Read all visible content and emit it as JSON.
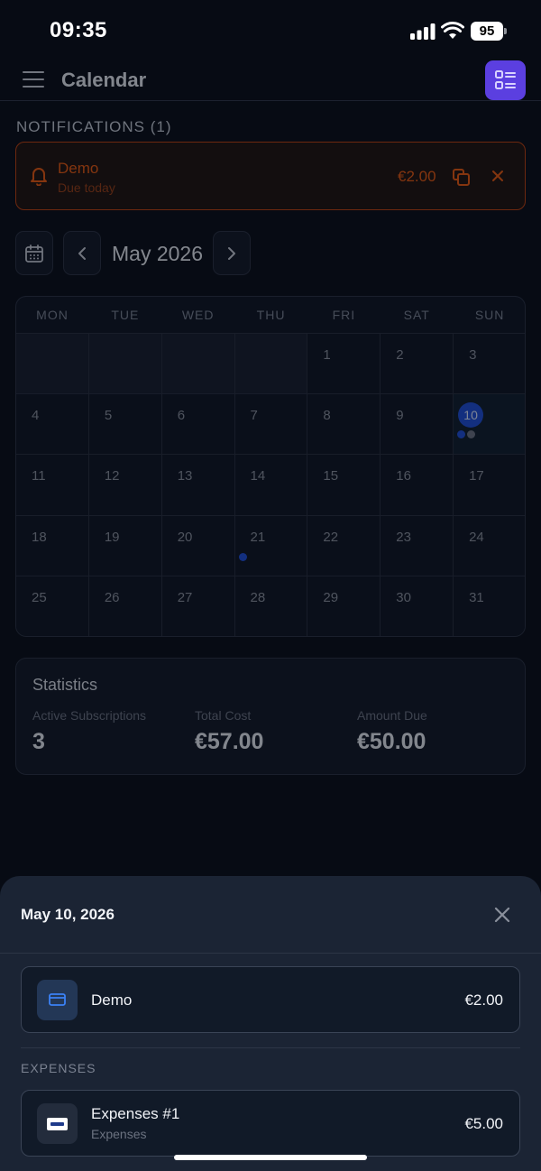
{
  "status_bar": {
    "time": "09:35",
    "battery": "95"
  },
  "header": {
    "title": "Calendar"
  },
  "notifications": {
    "heading": "NOTIFICATIONS (1)",
    "items": [
      {
        "title": "Demo",
        "subtitle": "Due today",
        "amount": "€2.00"
      }
    ]
  },
  "calendar": {
    "month_label": "May 2026",
    "weekdays": [
      "MON",
      "TUE",
      "WED",
      "THU",
      "FRI",
      "SAT",
      "SUN"
    ],
    "weeks": [
      [
        "",
        "",
        "",
        "",
        "1",
        "2",
        "3"
      ],
      [
        "4",
        "5",
        "6",
        "7",
        "8",
        "9",
        "10"
      ],
      [
        "11",
        "12",
        "13",
        "14",
        "15",
        "16",
        "17"
      ],
      [
        "18",
        "19",
        "20",
        "21",
        "22",
        "23",
        "24"
      ],
      [
        "25",
        "26",
        "27",
        "28",
        "29",
        "30",
        "31"
      ]
    ],
    "today": "10",
    "event_dots": {
      "10": [
        "#1d4ed8",
        "#6b7280"
      ],
      "21": [
        "#1d4ed8"
      ]
    }
  },
  "statistics": {
    "title": "Statistics",
    "active_label": "Active Subscriptions",
    "active_value": "3",
    "total_label": "Total Cost",
    "total_value": "€57.00",
    "due_label": "Amount Due",
    "due_value": "€50.00"
  },
  "sheet": {
    "date": "May 10, 2026",
    "subscription": {
      "name": "Demo",
      "amount": "€2.00"
    },
    "expenses_label": "EXPENSES",
    "expense": {
      "name": "Expenses #1",
      "category": "Expenses",
      "amount": "€5.00"
    }
  },
  "colors": {
    "accent": "#5b3fe0",
    "alert": "#ea580c",
    "today": "#1d4ed8"
  }
}
